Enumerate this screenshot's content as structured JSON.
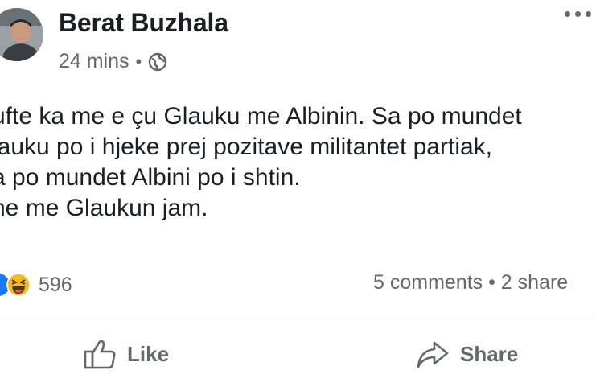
{
  "post": {
    "author": "Berat Buzhala",
    "time": "24 mins",
    "separator": "•",
    "privacy_icon": "globe-icon",
    "lines": [
      "ufte ka me e çu Glauku me Albinin. Sa po mundet",
      "lauku po i hjeke prej pozitave militantet partiak,",
      "a po mundet Albini po i shtin.",
      "ne me Glaukun jam."
    ]
  },
  "reactions": {
    "icons": [
      "like-reaction-icon",
      "haha-reaction-icon"
    ],
    "count": "596"
  },
  "engagement": {
    "summary": "5 comments • 2 share"
  },
  "actions": {
    "like_label": "Like",
    "share_label": "Share"
  },
  "colors": {
    "text": "#1c1e21",
    "secondary": "#65676b",
    "like_blue": "#1877f2",
    "haha_yellow": "#f7b928",
    "divider": "#ced0d4"
  }
}
